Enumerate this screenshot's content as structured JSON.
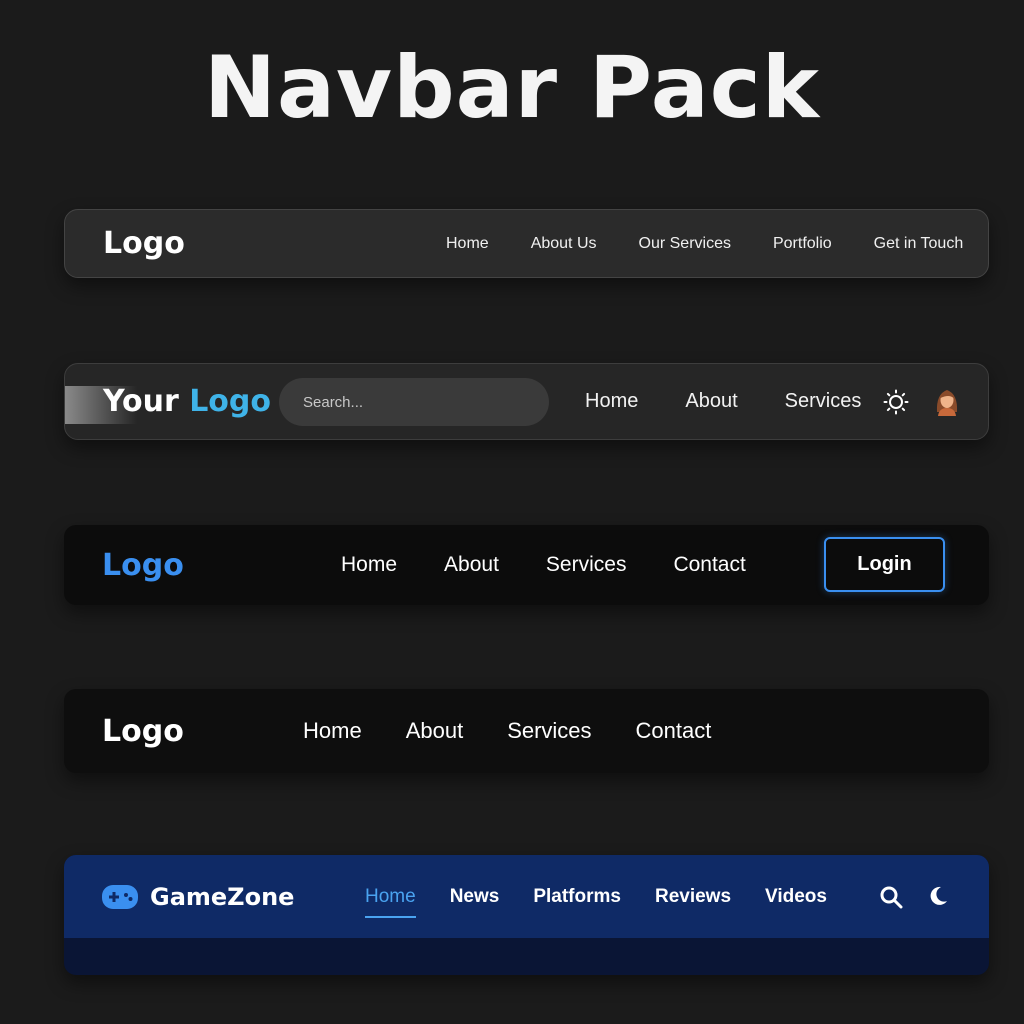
{
  "title": "Navbar Pack",
  "navbar1": {
    "logo": "Logo",
    "links": [
      "Home",
      "About Us",
      "Our Services",
      "Portfolio",
      "Get in Touch"
    ]
  },
  "navbar2": {
    "logo_part1": "Your",
    "logo_part2": "Logo",
    "search_placeholder": "Search...",
    "links": [
      "Home",
      "About",
      "Services"
    ],
    "icons": [
      "sun-icon",
      "avatar-icon"
    ],
    "accent_color": "#3fb3e8"
  },
  "navbar3": {
    "logo": "Logo",
    "links": [
      "Home",
      "About",
      "Services",
      "Contact"
    ],
    "login_label": "Login",
    "accent_color": "#3a8ff0"
  },
  "navbar4": {
    "logo": "Logo",
    "links": [
      "Home",
      "About",
      "Services",
      "Contact"
    ]
  },
  "navbar5": {
    "brand": "GameZone",
    "links": [
      "Home",
      "News",
      "Platforms",
      "Reviews",
      "Videos"
    ],
    "active_link": "Home",
    "icons": [
      "gamepad-icon",
      "search-icon",
      "moon-icon"
    ],
    "bar_color": "#0f2a66",
    "accent_color": "#4aa3f0"
  }
}
